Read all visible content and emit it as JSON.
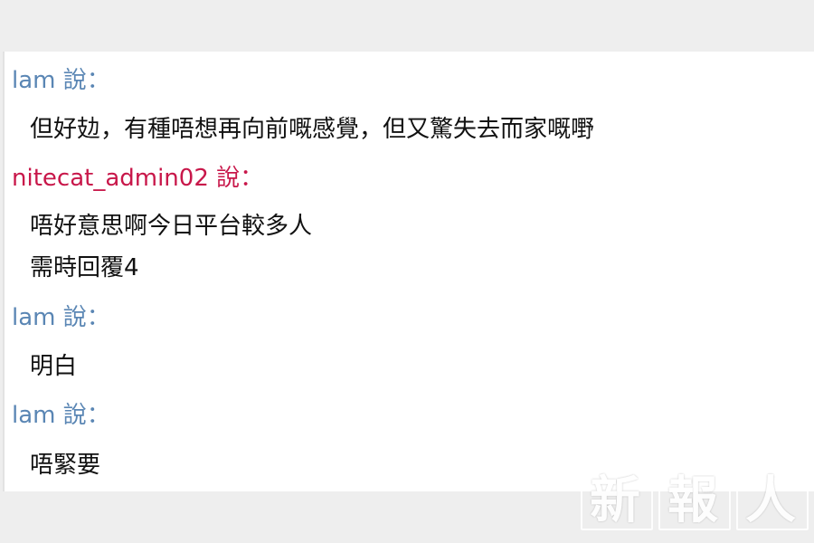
{
  "messages": [
    {
      "sender": "lam 說：",
      "lines": [
        "但好攰，有種唔想再向前嘅感覺，但又驚失去而家嘅嘢"
      ]
    },
    {
      "sender": "nitecat_admin02 說：",
      "lines": [
        "唔好意思啊今日平台較多人",
        "需時回覆4"
      ]
    },
    {
      "sender": "lam 說：",
      "lines": [
        "明白"
      ]
    },
    {
      "sender": "lam 說：",
      "lines": [
        "唔緊要"
      ]
    }
  ],
  "watermark": {
    "chars": [
      "新",
      "報",
      "人"
    ]
  },
  "colors": {
    "user_name": "#5a86b4",
    "admin_name": "#c8174a",
    "message_text": "#111111",
    "page_bg": "#eeeeee",
    "chat_bg": "#ffffff"
  }
}
